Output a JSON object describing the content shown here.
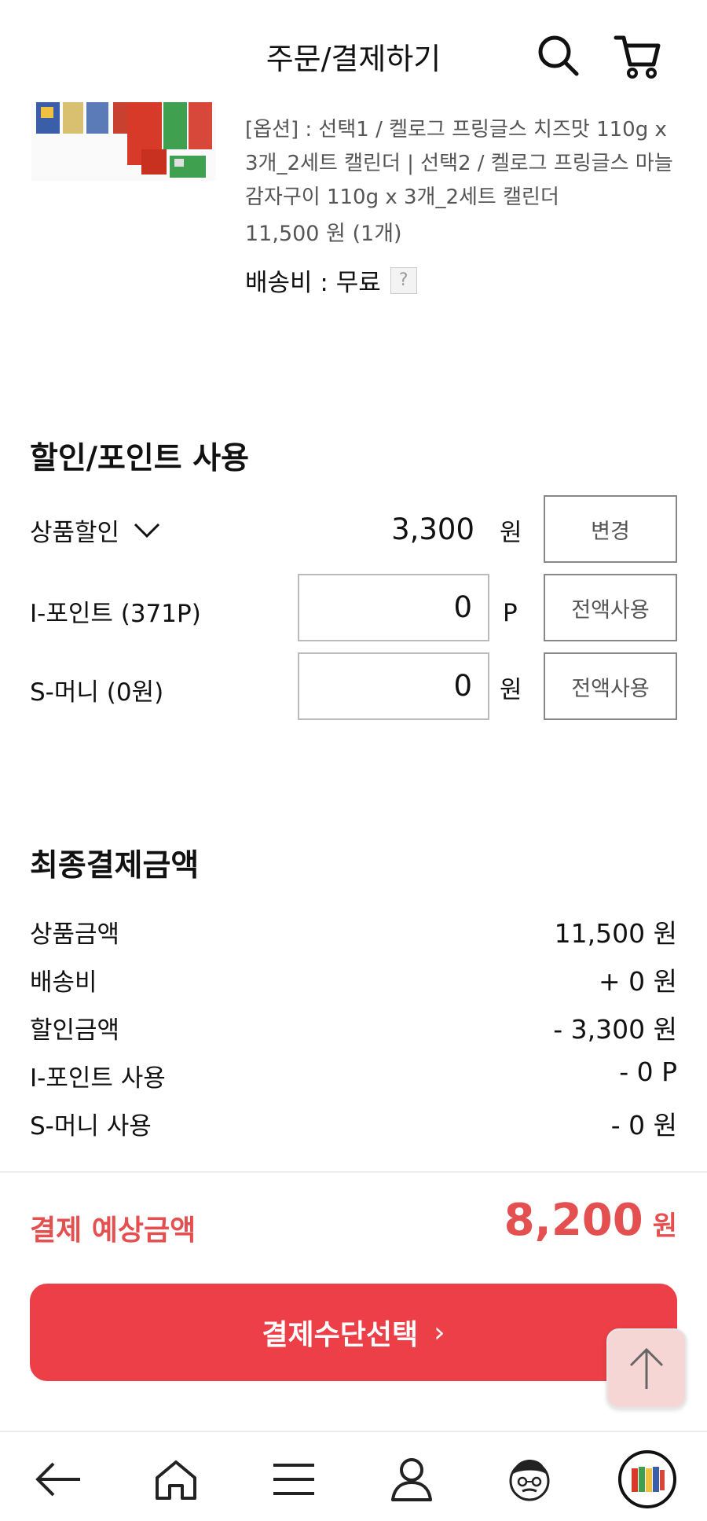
{
  "header": {
    "title": "주문/결제하기",
    "icons": [
      "search-icon",
      "cart-icon"
    ]
  },
  "product": {
    "options_text": "[옵션] : 선택1 / 켈로그 프링글스 치즈맛 110g x 3개_2세트 캘린더 | 선택2 / 켈로그 프링글스 마늘 감자구이 110g x 3개_2세트 캘린더",
    "price_text": "11,500 원 (1개)",
    "shipping_label": "배송비 : 무료",
    "help_label": "?"
  },
  "discount": {
    "title": "할인/포인트 사용",
    "coupon": {
      "label": "상품할인",
      "value": "3,300",
      "unit": "원",
      "button": "변경"
    },
    "ipoint": {
      "label": "I-포인트 (371P)",
      "value": "0",
      "unit": "P",
      "button": "전액사용"
    },
    "smoney": {
      "label": "S-머니 (0원)",
      "value": "0",
      "unit": "원",
      "button": "전액사용"
    }
  },
  "final": {
    "title": "최종결제금액",
    "rows": [
      {
        "label": "상품금액",
        "value": "11,500 원"
      },
      {
        "label": "배송비",
        "value": "+ 0 원"
      },
      {
        "label": "할인금액",
        "value": "- 3,300 원"
      },
      {
        "label": "I-포인트 사용",
        "value": "- 0 P"
      },
      {
        "label": "S-머니 사용",
        "value": "- 0 원"
      }
    ],
    "expected_label": "결제 예상금액",
    "expected_amount": "8,200",
    "expected_unit": "원"
  },
  "pay_button": {
    "label": "결제수단선택",
    "chevron": "›"
  },
  "colors": {
    "accent": "#ec3f47",
    "accent_text": "#e45050"
  },
  "bottom_nav": [
    "back-arrow-icon",
    "home-icon",
    "menu-icon",
    "profile-icon",
    "character-icon",
    "recent-product-icon"
  ]
}
